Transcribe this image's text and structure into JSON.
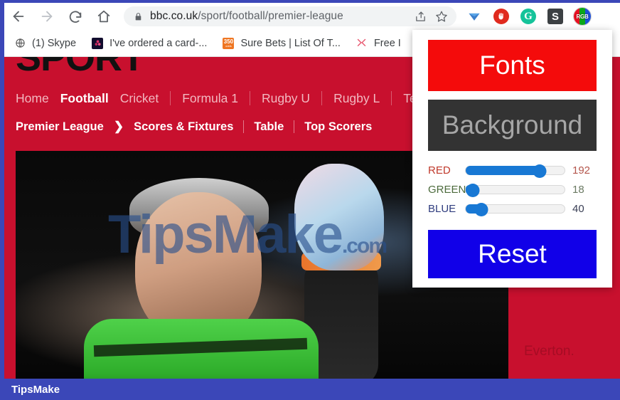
{
  "browser": {
    "back_icon": "arrow-left-icon",
    "forward_icon": "arrow-right-icon",
    "reload_icon": "reload-icon",
    "home_icon": "home-icon",
    "omnibox": {
      "lock_icon": "lock-icon",
      "url_prefix": "bbc.co.uk",
      "url_path": "/sport/football/premier-league",
      "share_icon": "share-icon",
      "bookmark_star_icon": "star-icon"
    },
    "extensions": [
      {
        "name": "vimeo-extension-icon",
        "label": ""
      },
      {
        "name": "adblock-extension-icon",
        "label": ""
      },
      {
        "name": "grammarly-extension-icon",
        "label": "G"
      },
      {
        "name": "s-extension-icon",
        "label": "S"
      },
      {
        "name": "rgb-extension-icon",
        "label": "RGB"
      }
    ]
  },
  "bookmarks": [
    {
      "label": "(1) Skype",
      "icon": "skype-icon"
    },
    {
      "label": "I've ordered a card-...",
      "icon": "card-site-icon"
    },
    {
      "label": "Sure Bets | List Of T...",
      "icon": "350-icon",
      "icon_text": "350",
      "icon_subtext": "odds"
    },
    {
      "label": "Free I",
      "icon": "free-bets-icon"
    }
  ],
  "page": {
    "site_logo": "SPORT",
    "nav_main": [
      {
        "label": "Home",
        "active": false
      },
      {
        "label": "Football",
        "active": true
      },
      {
        "label": "Cricket",
        "active": false
      },
      {
        "label": "Formula 1",
        "active": false
      },
      {
        "label": "Rugby U",
        "active": false
      },
      {
        "label": "Rugby L",
        "active": false
      },
      {
        "label": "Te",
        "active": false
      }
    ],
    "nav_sub": {
      "section": "Premier League",
      "chevron": "❯",
      "items": [
        "Scores & Fixtures",
        "Table",
        "Top Scorers"
      ]
    },
    "photo_watermark": "TipsMake",
    "photo_watermark_suffix": ".com",
    "caption_text": "Everton."
  },
  "popup": {
    "fonts_label": "Fonts",
    "fonts_color": "#f40b0b",
    "background_label": "Background",
    "background_color": "#333333",
    "reset_label": "Reset",
    "reset_color": "#1100e8",
    "sliders": [
      {
        "label": "RED",
        "value": 192,
        "percent": 75,
        "channel": "red"
      },
      {
        "label": "GREEN",
        "value": 18,
        "percent": 7,
        "channel": "green"
      },
      {
        "label": "BLUE",
        "value": 40,
        "percent": 16,
        "channel": "blue"
      }
    ]
  },
  "footer": {
    "label": "TipsMake"
  }
}
